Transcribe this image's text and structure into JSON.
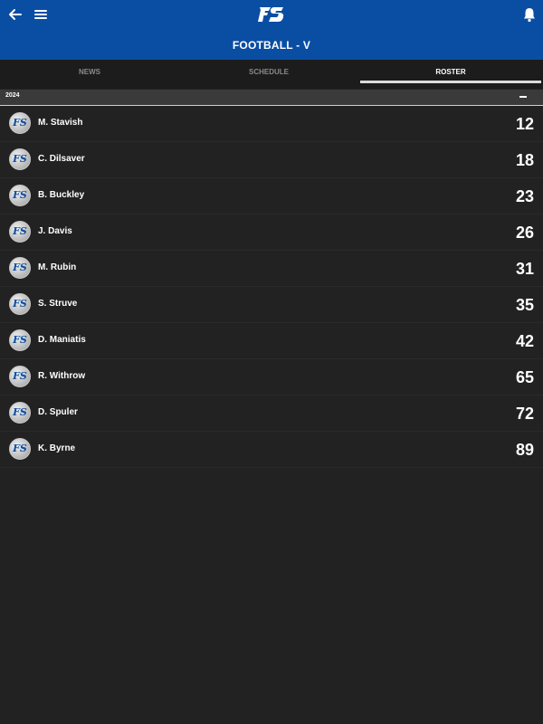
{
  "header": {
    "title": "FOOTBALL - V",
    "logo_text": "FS"
  },
  "tabs": [
    {
      "label": "NEWS"
    },
    {
      "label": "SCHEDULE"
    },
    {
      "label": "ROSTER"
    }
  ],
  "active_tab": "ROSTER",
  "section": {
    "year": "2024"
  },
  "roster": [
    {
      "name": "M. Stavish",
      "number": "12"
    },
    {
      "name": "C. Dilsaver",
      "number": "18"
    },
    {
      "name": "B. Buckley",
      "number": "23"
    },
    {
      "name": "J. Davis",
      "number": "26"
    },
    {
      "name": "M. Rubin",
      "number": "31"
    },
    {
      "name": "S. Struve",
      "number": "35"
    },
    {
      "name": "D. Maniatis",
      "number": "42"
    },
    {
      "name": "R. Withrow",
      "number": "65"
    },
    {
      "name": "D. Spuler",
      "number": "72"
    },
    {
      "name": "K. Byrne",
      "number": "89"
    }
  ],
  "colors": {
    "header_bg": "#0a4ea3",
    "page_bg": "#222222",
    "accent_text": "#ffffff"
  }
}
